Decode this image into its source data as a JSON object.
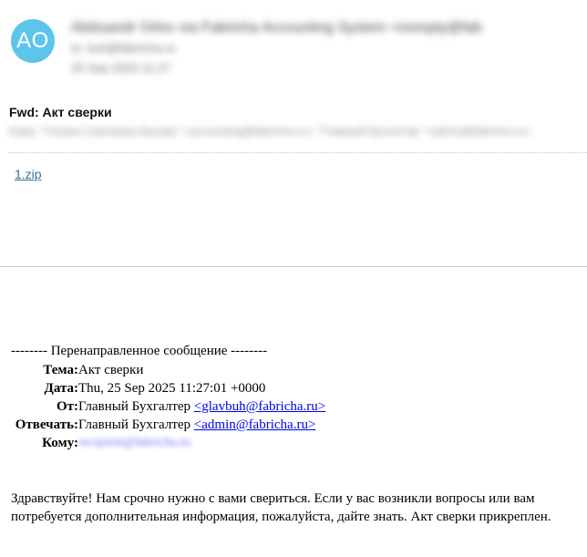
{
  "sender": {
    "avatar_initials": "AO",
    "avatar_color": "#5cc6ea",
    "name_redacted": "Aleksandr Orlov via Fabricha Accounting System <noreply@fabricha.ru>",
    "line2_redacted": "to: buh@fabricha.ru",
    "line3_redacted": "25 Sep 2025 11:27"
  },
  "message": {
    "subject": "Fwd: Акт сверки",
    "recipients_redacted": "Кому: \"Галина Сергеевна Бухова\" <accounting@fabricha.ru>; \"Главный бухгалтер\" <admin@fabricha.ru>",
    "attachment_name": "1.zip"
  },
  "forwarded": {
    "header_line": "-------- Перенаправленное сообщение --------",
    "fields": {
      "subject": {
        "label": "Тема:",
        "value": "Акт сверки"
      },
      "date": {
        "label": "Дата:",
        "value": "Thu, 25 Sep 2025 11:27:01 +0000"
      },
      "from": {
        "label": "От:",
        "name": "Главный Бухгалтер",
        "email": "<glavbuh@fabricha.ru>"
      },
      "reply_to": {
        "label": "Отвечать:",
        "name": "Главный Бухгалтер",
        "email": "<admin@fabricha.ru>"
      },
      "to": {
        "label": "Кому:",
        "value_redacted": "recipient@fabricha.ru"
      }
    },
    "body": "Здравствуйте! Нам срочно нужно с вами свериться. Если у вас возникли вопросы или вам потребуется дополнительная информация, пожалуйста, дайте знать. Акт сверки прикреплен."
  }
}
